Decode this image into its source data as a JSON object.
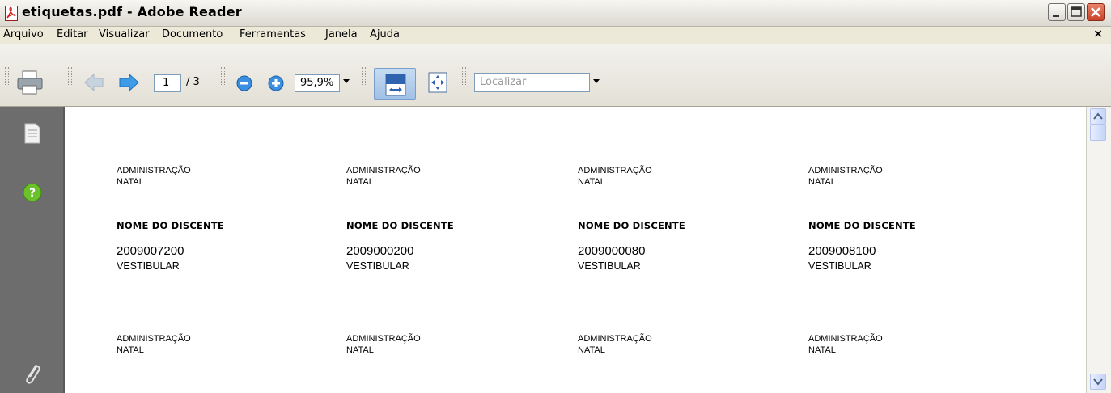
{
  "window": {
    "title": "etiquetas.pdf - Adobe Reader"
  },
  "menu": {
    "items": [
      "Arquivo",
      "Editar",
      "Visualizar",
      "Documento",
      "Ferramentas",
      "Janela",
      "Ajuda"
    ],
    "close_glyph": "×"
  },
  "toolbar": {
    "current_page": "1",
    "total_pages": "/ 3",
    "zoom": "95,9%",
    "search_placeholder": "Localizar"
  },
  "document": {
    "labels_row1": [
      {
        "curso": "ADMINISTRAÇÃO",
        "cidade": "NATAL",
        "nome": "NOME DO DISCENTE",
        "matricula": "2009007200",
        "ingresso": "VESTIBULAR"
      },
      {
        "curso": "ADMINISTRAÇÃO",
        "cidade": "NATAL",
        "nome": "NOME DO DISCENTE",
        "matricula": "2009000200",
        "ingresso": "VESTIBULAR"
      },
      {
        "curso": "ADMINISTRAÇÃO",
        "cidade": "NATAL",
        "nome": "NOME DO DISCENTE",
        "matricula": "2009000080",
        "ingresso": "VESTIBULAR"
      },
      {
        "curso": "ADMINISTRAÇÃO",
        "cidade": "NATAL",
        "nome": "NOME DO DISCENTE",
        "matricula": "2009008100",
        "ingresso": "VESTIBULAR"
      }
    ],
    "labels_row2": [
      {
        "curso": "ADMINISTRAÇÃO",
        "cidade": "NATAL"
      },
      {
        "curso": "ADMINISTRAÇÃO",
        "cidade": "NATAL"
      },
      {
        "curso": "ADMINISTRAÇÃO",
        "cidade": "NATAL"
      },
      {
        "curso": "ADMINISTRAÇÃO",
        "cidade": "NATAL"
      }
    ]
  },
  "icons": {
    "app": "adobe-pdf-icon",
    "print": "printer-icon",
    "prev": "arrow-left-icon",
    "next": "arrow-right-icon",
    "zoom_out": "zoom-out-icon",
    "zoom_in": "zoom-in-icon",
    "fit_width": "fit-width-icon",
    "fit_page": "fit-page-icon",
    "pages": "pages-icon",
    "help": "help-icon",
    "attachments": "paperclip-icon"
  }
}
